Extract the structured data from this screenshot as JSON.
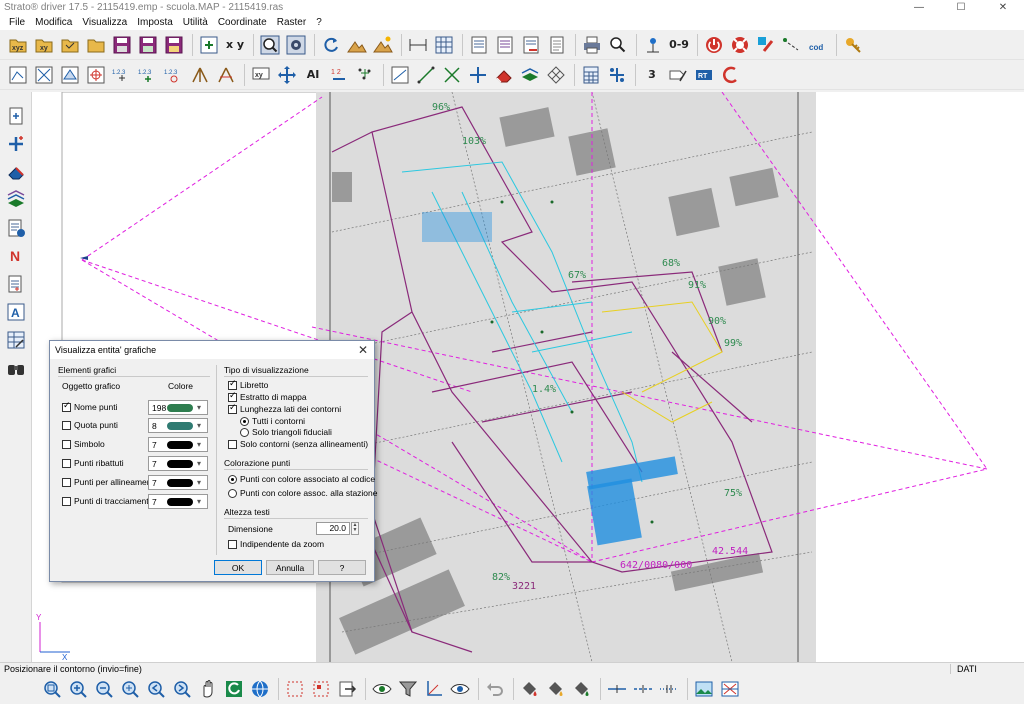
{
  "window": {
    "title": "Strato® driver 17.5 - 2115419.emp - scuola.MAP - 2115419.ras",
    "minimize_glyph": "—",
    "maximize_glyph": "☐",
    "close_glyph": "✕"
  },
  "menu": [
    "File",
    "Modifica",
    "Visualizza",
    "Imposta",
    "Utilità",
    "Coordinate",
    "Raster",
    "?"
  ],
  "toolbar_main": {
    "text_icons": {
      "xyz": "xyz",
      "xy": "xy",
      "xy_sep": "x y",
      "range": "0-9",
      "cod": "cod"
    }
  },
  "toolbar_secondary": {
    "text_icons": {
      "n123a": "1.2.3",
      "n123b": "1.2.3",
      "n123c": "1.2.3",
      "n12": "1 2",
      "xy": "xy",
      "AI": "AI",
      "three": "3"
    }
  },
  "left_tools": {
    "text_icons": {
      "N": "N",
      "A": "A"
    }
  },
  "map": {
    "percent_labels": [
      "96%",
      "103%",
      "67%",
      "68%",
      "91%",
      "90%",
      "99%",
      "82%",
      "75%",
      "1.4%"
    ],
    "code_labels": [
      "642/0080/000",
      "42.544",
      "3221"
    ],
    "axis_y": "Y",
    "axis_x": "X"
  },
  "dialog": {
    "title": "Visualizza entita' grafiche",
    "close_glyph": "✕",
    "elements_group": "Elementi grafici",
    "col_object": "Oggetto grafico",
    "col_color": "Colore",
    "rows": [
      {
        "label": "Nome punti",
        "checked": true,
        "color_num": "198",
        "swatch": "#2e7d4f"
      },
      {
        "label": "Quota punti",
        "checked": false,
        "color_num": "8",
        "swatch": "#2f7b72"
      },
      {
        "label": "Simbolo",
        "checked": false,
        "color_num": "7",
        "swatch": "#000000"
      },
      {
        "label": "Punti ribattuti",
        "checked": false,
        "color_num": "7",
        "swatch": "#000000"
      },
      {
        "label": "Punti per allineamento",
        "checked": false,
        "color_num": "7",
        "swatch": "#000000"
      },
      {
        "label": "Punti di tracciamento",
        "checked": false,
        "color_num": "7",
        "swatch": "#000000"
      }
    ],
    "display_group": "Tipo di visualizzazione",
    "display_options": [
      {
        "label": "Libretto",
        "checked": true
      },
      {
        "label": "Estratto di mappa",
        "checked": true
      },
      {
        "label": "Lunghezza lati dei contorni",
        "checked": true
      }
    ],
    "contour_radios": [
      {
        "label": "Tutti i contorni",
        "selected": true
      },
      {
        "label": "Solo triangoli fiduciali",
        "selected": false
      }
    ],
    "only_contours": {
      "label": "Solo contorni (senza allineamenti)",
      "checked": false
    },
    "coloring_group": "Colorazione punti",
    "coloring_radios": [
      {
        "label": "Punti con colore associato al codice",
        "selected": true
      },
      {
        "label": "Punti con colore assoc. alla stazione",
        "selected": false
      }
    ],
    "text_height_group": "Altezza testi",
    "dimension_label": "Dimensione",
    "dimension_value": "20.0",
    "zoom_independent": {
      "label": "Indipendente da zoom",
      "checked": false
    },
    "ok_label": "OK",
    "cancel_label": "Annulla",
    "help_label": "?"
  },
  "status": {
    "message": "Posizionare il contorno (invio=fine)",
    "right": "DATI"
  }
}
